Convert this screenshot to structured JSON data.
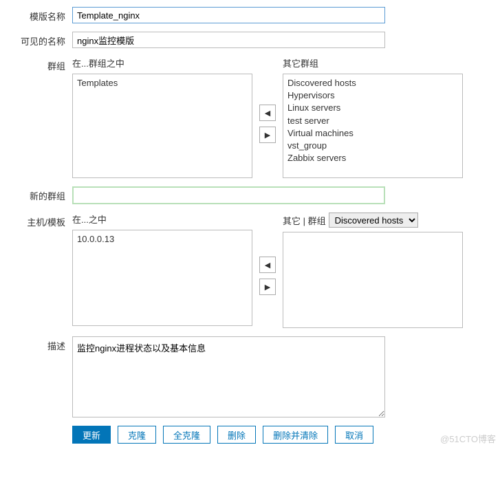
{
  "fields": {
    "template_name": {
      "label": "模版名称",
      "value": "Template_nginx"
    },
    "visible_name": {
      "label": "可见的名称",
      "value": "nginx监控模版"
    },
    "groups": {
      "label": "群组",
      "in_label": "在...群组之中",
      "other_label": "其它群组",
      "in_items": [
        "Templates"
      ],
      "other_items": [
        "Discovered hosts",
        "Hypervisors",
        "Linux servers",
        "test server",
        "Virtual machines",
        "vst_group",
        "Zabbix servers"
      ]
    },
    "new_group": {
      "label": "新的群组",
      "value": ""
    },
    "hosts": {
      "label": "主机/模板",
      "in_label": "在...之中",
      "other_label": "其它 | 群组",
      "select_value": "Discovered hosts",
      "in_items": [
        "10.0.0.13"
      ],
      "other_items": []
    },
    "description": {
      "label": "描述",
      "value": "监控nginx进程状态以及基本信息"
    }
  },
  "buttons": {
    "update": "更新",
    "clone": "克隆",
    "full_clone": "全克隆",
    "delete": "删除",
    "delete_clear": "删除并清除",
    "cancel": "取消"
  },
  "watermark": "@51CTO博客"
}
